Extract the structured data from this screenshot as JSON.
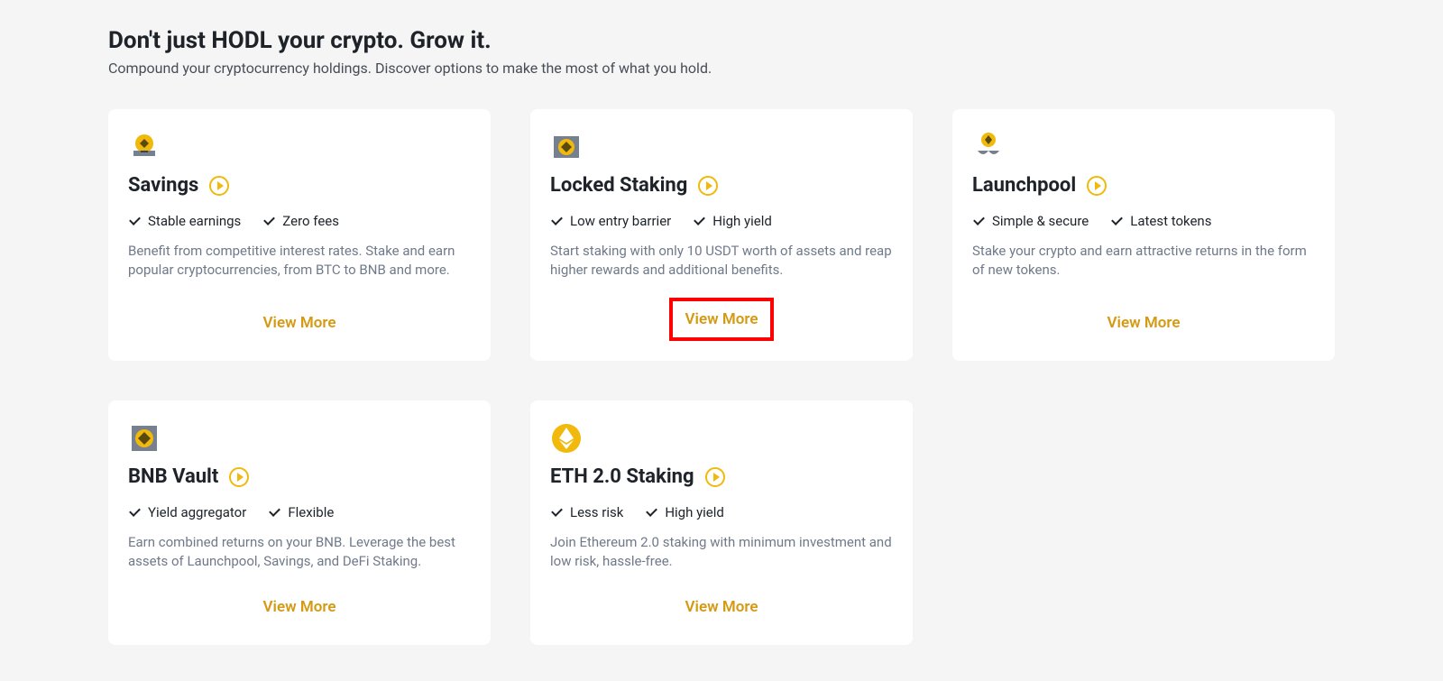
{
  "header": {
    "title": "Don't just HODL your crypto. Grow it.",
    "subtitle": "Compound your cryptocurrency holdings. Discover options to make the most of what you hold."
  },
  "colors": {
    "accent": "#f0b90b",
    "link": "#d59a13",
    "highlight_border": "#ff0000"
  },
  "cards": [
    {
      "id": "savings",
      "title": "Savings",
      "features": [
        "Stable earnings",
        "Zero fees"
      ],
      "description": "Benefit from competitive interest rates. Stake and earn popular cryptocurrencies, from BTC to BNB and more.",
      "cta": "View More",
      "highlighted": false,
      "icon": "savings-icon"
    },
    {
      "id": "locked-staking",
      "title": "Locked Staking",
      "features": [
        "Low entry barrier",
        "High yield"
      ],
      "description": "Start staking with only 10 USDT worth of assets and reap higher rewards and additional benefits.",
      "cta": "View More",
      "highlighted": true,
      "icon": "locked-staking-icon"
    },
    {
      "id": "launchpool",
      "title": "Launchpool",
      "features": [
        "Simple & secure",
        "Latest tokens"
      ],
      "description": "Stake your crypto and earn attractive returns in the form of new tokens.",
      "cta": "View More",
      "highlighted": false,
      "icon": "launchpool-icon"
    },
    {
      "id": "bnb-vault",
      "title": "BNB Vault",
      "features": [
        "Yield aggregator",
        "Flexible"
      ],
      "description": "Earn combined returns on your BNB. Leverage the best assets of Launchpool, Savings, and DeFi Staking.",
      "cta": "View More",
      "highlighted": false,
      "icon": "bnb-vault-icon"
    },
    {
      "id": "eth2-staking",
      "title": "ETH 2.0 Staking",
      "features": [
        "Less risk",
        "High yield"
      ],
      "description": "Join Ethereum 2.0 staking with minimum investment and low risk, hassle-free.",
      "cta": "View More",
      "highlighted": false,
      "icon": "eth2-staking-icon"
    }
  ]
}
